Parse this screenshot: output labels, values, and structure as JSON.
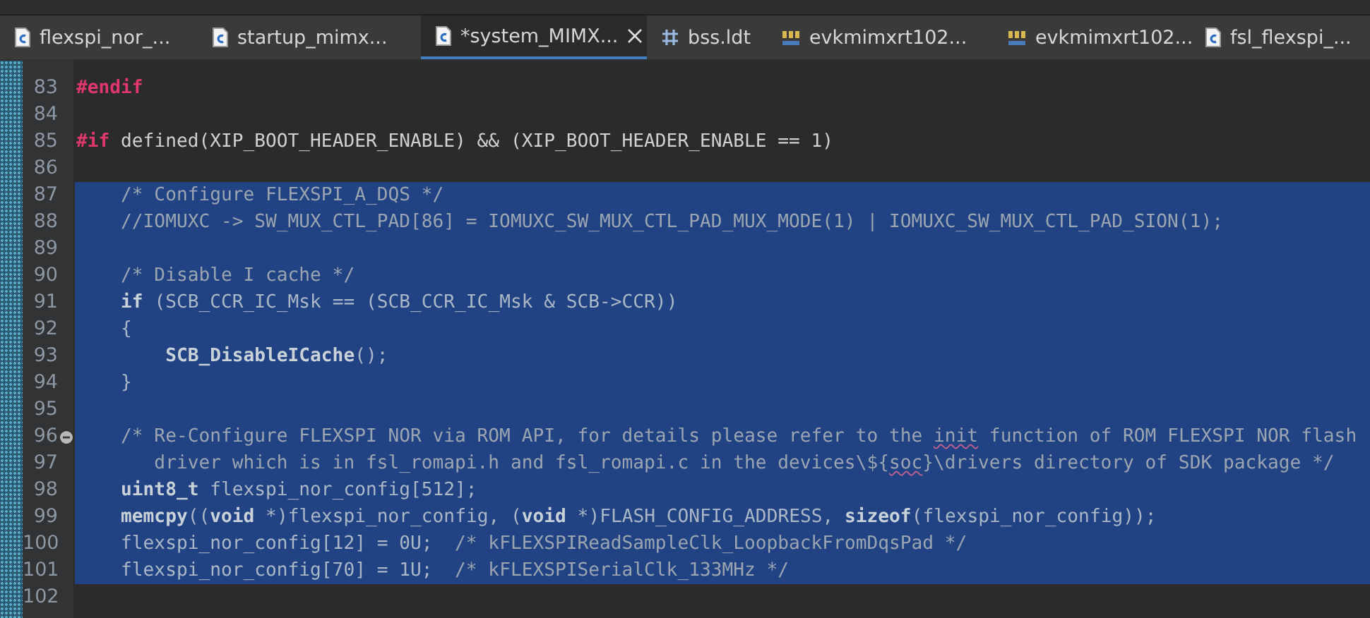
{
  "tabs": [
    {
      "label": "flexspi_nor_...",
      "kind": "c-file",
      "selected": false
    },
    {
      "label": "startup_mimx...",
      "kind": "c-file",
      "selected": false
    },
    {
      "label": "*system_MIMX...",
      "kind": "c-file",
      "selected": true
    },
    {
      "label": "bss.ldt",
      "kind": "linker",
      "selected": false
    },
    {
      "label": "evkmimxrt102...",
      "kind": "binary",
      "selected": false
    },
    {
      "label": "evkmimxrt102...",
      "kind": "binary",
      "selected": false
    },
    {
      "label": "fsl_flexspi_...",
      "kind": "c-file",
      "selected": false
    }
  ],
  "editor": {
    "lines": [
      {
        "number": "83",
        "selected": false,
        "fold_marker": false,
        "tokens": [
          {
            "kind": "directive",
            "text": "#endif"
          }
        ]
      },
      {
        "number": "84",
        "selected": false,
        "fold_marker": false
      },
      {
        "number": "85",
        "selected": false,
        "fold_marker": false,
        "tokens": [
          {
            "kind": "directive",
            "text": "#if"
          },
          {
            "kind": "plain",
            "text": " defined(XIP_BOOT_HEADER_ENABLE) && (XIP_BOOT_HEADER_ENABLE == 1)"
          }
        ]
      },
      {
        "number": "86",
        "selected": false,
        "fold_marker": false
      },
      {
        "number": "87",
        "selected": true,
        "fold_marker": false,
        "tokens": [
          {
            "kind": "comment",
            "text": "    /* Configure FLEXSPI_A_DQS */"
          }
        ]
      },
      {
        "number": "88",
        "selected": true,
        "fold_marker": false,
        "tokens": [
          {
            "kind": "comment",
            "text": "    //IOMUXC -> SW_MUX_CTL_PAD[86] = IOMUXC_SW_MUX_CTL_PAD_MUX_MODE(1) | IOMUXC_SW_MUX_CTL_PAD_SION(1);"
          }
        ]
      },
      {
        "number": "89",
        "selected": true,
        "fold_marker": false
      },
      {
        "number": "90",
        "selected": true,
        "fold_marker": false,
        "tokens": [
          {
            "kind": "comment",
            "text": "    /* Disable I cache */"
          }
        ]
      },
      {
        "number": "91",
        "selected": true,
        "fold_marker": false,
        "tokens": [
          {
            "kind": "keyword",
            "text": "    if"
          },
          {
            "kind": "plain",
            "text": " (SCB_CCR_IC_Msk == (SCB_CCR_IC_Msk & SCB->CCR))"
          }
        ]
      },
      {
        "number": "92",
        "selected": true,
        "fold_marker": false,
        "tokens": [
          {
            "kind": "plain",
            "text": "    {"
          }
        ]
      },
      {
        "number": "93",
        "selected": true,
        "fold_marker": false,
        "tokens": [
          {
            "kind": "keyword",
            "text": "        SCB_DisableICache"
          },
          {
            "kind": "plain",
            "text": "();"
          }
        ]
      },
      {
        "number": "94",
        "selected": true,
        "fold_marker": false,
        "tokens": [
          {
            "kind": "plain",
            "text": "    }"
          }
        ]
      },
      {
        "number": "95",
        "selected": true,
        "fold_marker": false
      },
      {
        "number": "96",
        "selected": true,
        "fold_marker": true,
        "tokens": [
          {
            "kind": "comment",
            "text": "    /* Re-Configure FLEXSPI NOR via ROM API, for details please refer to the "
          },
          {
            "kind": "misspelled",
            "text": "init"
          },
          {
            "kind": "comment",
            "text": " function of ROM FLEXSPI NOR flash"
          }
        ]
      },
      {
        "number": "97",
        "selected": true,
        "fold_marker": false,
        "tokens": [
          {
            "kind": "comment",
            "text": "       driver which is in fsl_romapi.h and fsl_romapi.c in the devices\\${"
          },
          {
            "kind": "misspelled",
            "text": "soc"
          },
          {
            "kind": "comment",
            "text": "}\\drivers directory of SDK package */"
          }
        ]
      },
      {
        "number": "98",
        "selected": true,
        "fold_marker": false,
        "tokens": [
          {
            "kind": "keyword",
            "text": "    uint8_t"
          },
          {
            "kind": "plain",
            "text": " flexspi_nor_config[512];"
          }
        ]
      },
      {
        "number": "99",
        "selected": true,
        "fold_marker": false,
        "tokens": [
          {
            "kind": "keyword",
            "text": "    memcpy"
          },
          {
            "kind": "plain",
            "text": "(("
          },
          {
            "kind": "keyword",
            "text": "void"
          },
          {
            "kind": "plain",
            "text": " *)flexspi_nor_config, ("
          },
          {
            "kind": "keyword",
            "text": "void"
          },
          {
            "kind": "plain",
            "text": " *)FLASH_CONFIG_ADDRESS, "
          },
          {
            "kind": "keyword",
            "text": "sizeof"
          },
          {
            "kind": "plain",
            "text": "(flexspi_nor_config));"
          }
        ]
      },
      {
        "number": "100",
        "selected": true,
        "fold_marker": false,
        "tokens": [
          {
            "kind": "plain",
            "text": "    flexspi_nor_config[12] = 0U;  "
          },
          {
            "kind": "comment",
            "text": "/* kFLEXSPIReadSampleClk_LoopbackFromDqsPad */"
          }
        ]
      },
      {
        "number": "101",
        "selected": true,
        "fold_marker": false,
        "tokens": [
          {
            "kind": "plain",
            "text": "    flexspi_nor_config[70] = 1U;  "
          },
          {
            "kind": "comment",
            "text": "/* kFLEXSPISerialClk_133MHz */"
          }
        ]
      },
      {
        "number": "102",
        "selected": false,
        "fold_marker": false
      }
    ]
  }
}
